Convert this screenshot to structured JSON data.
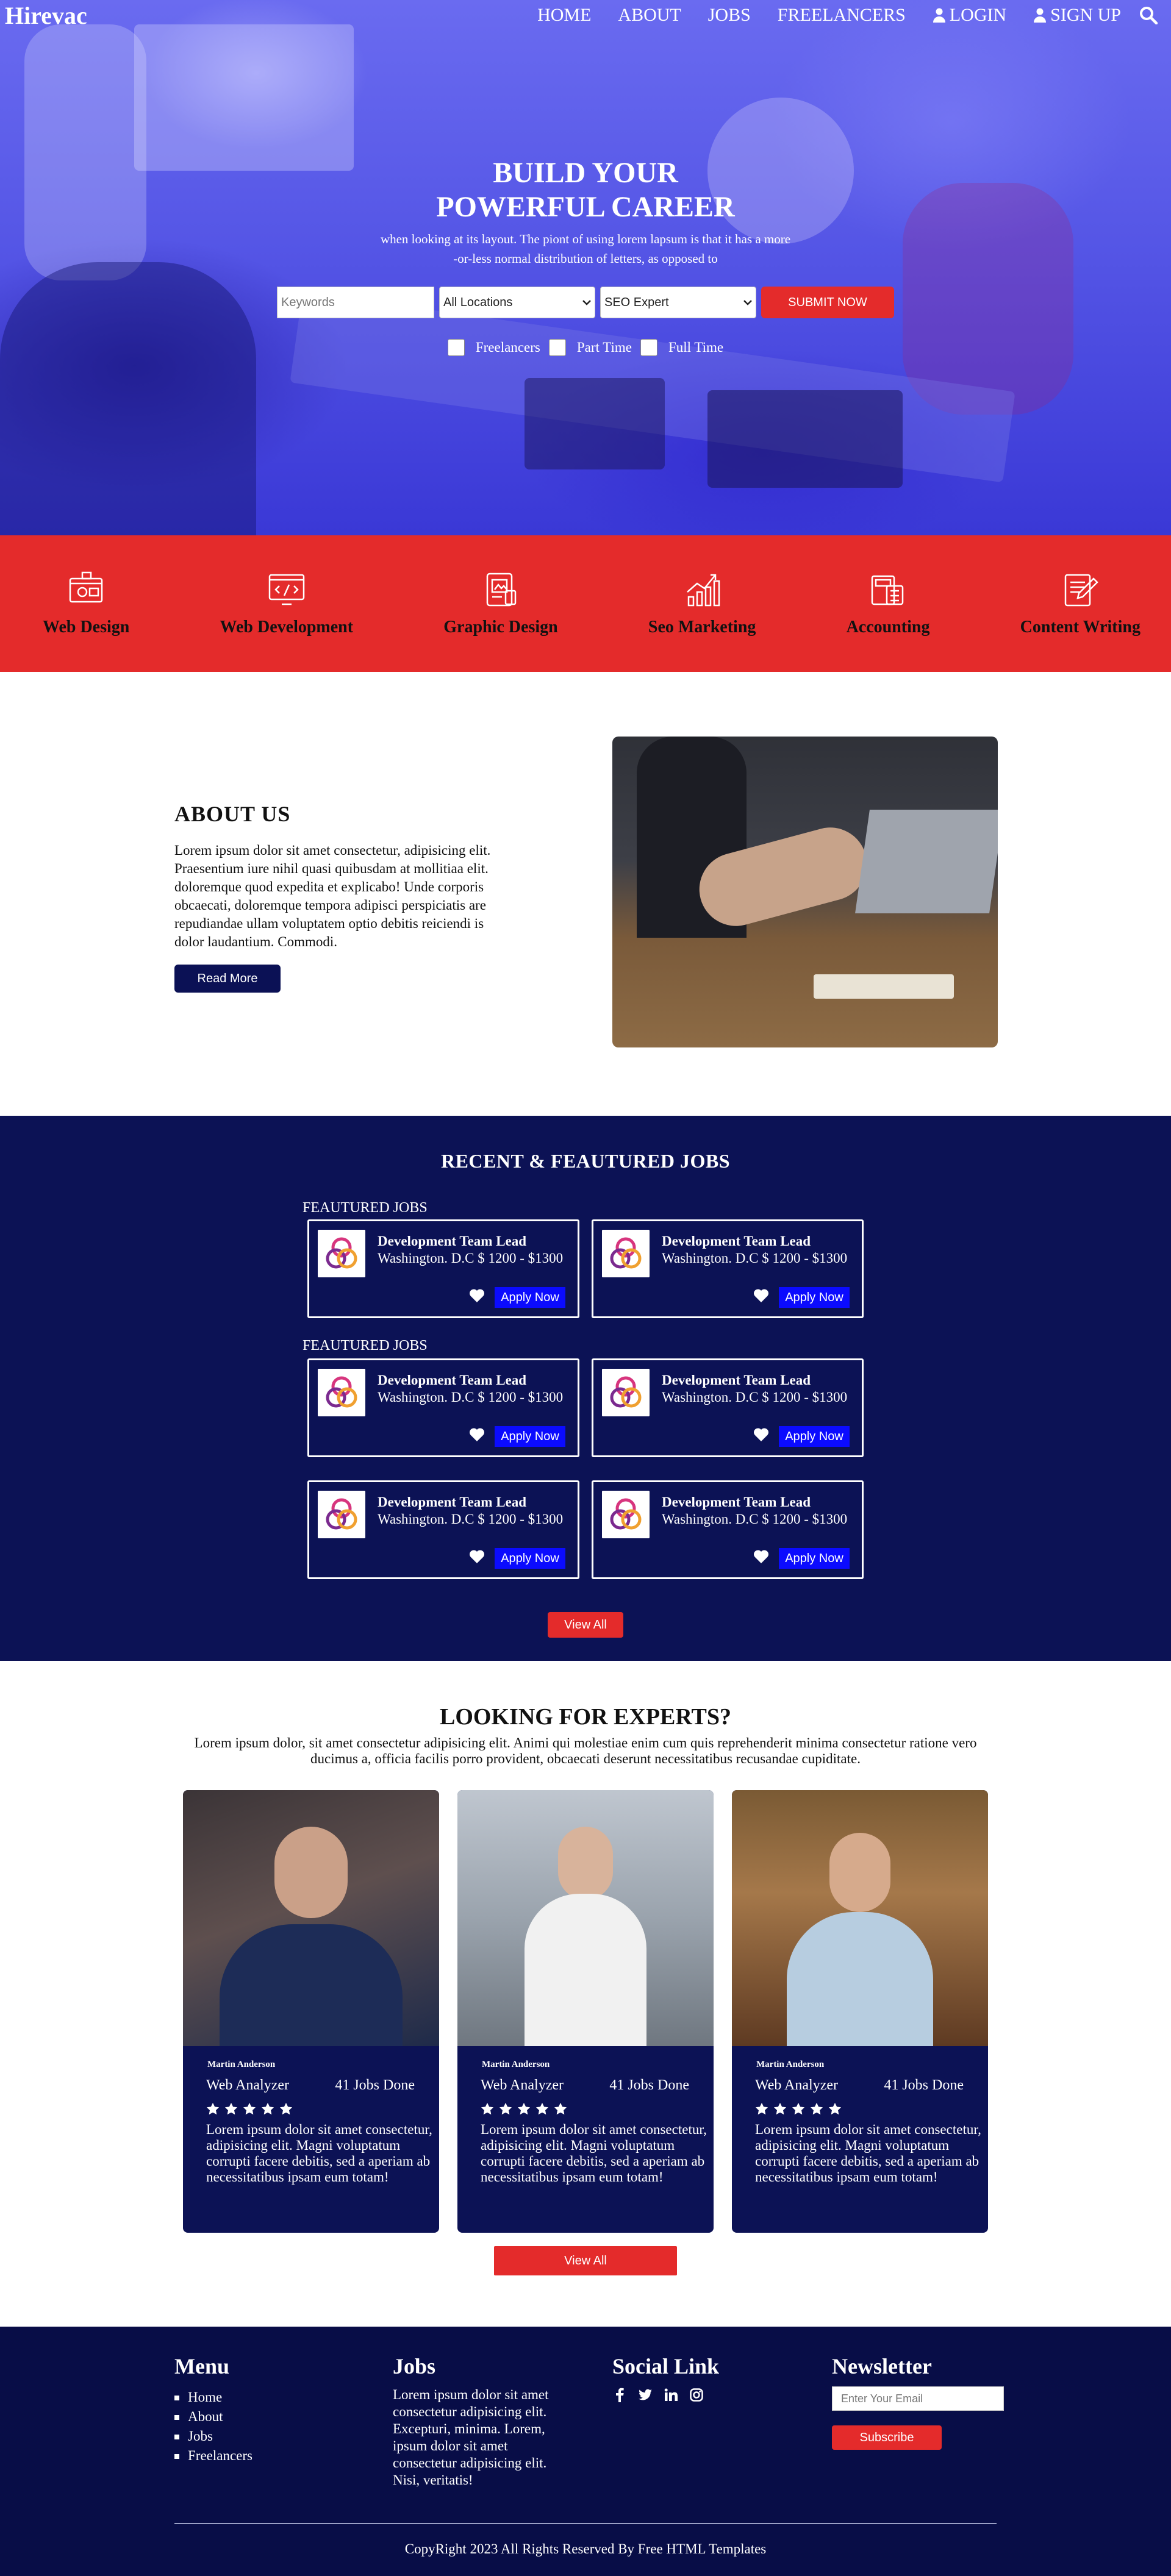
{
  "nav": {
    "brand": "Hirevac",
    "links": [
      "HOME",
      "ABOUT",
      "JOBS",
      "FREELANCERS",
      "LOGIN",
      "SIGN UP"
    ],
    "search_icon": "search-icon",
    "user_icon": "user-icon"
  },
  "hero": {
    "title_line1": "BUILD YOUR",
    "title_line2": "POWERFUL CAREER",
    "subtitle_line1": "when looking at its layout. The piont of using lorem lapsum is that it has a more",
    "subtitle_line2": "-or-less normal distribution of letters, as opposed to",
    "keyword_placeholder": "Keywords",
    "location_value": "All Locations",
    "category_value": "SEO Expert",
    "submit_label": "SUBMIT NOW",
    "filters": [
      "Freelancers",
      "Part Time",
      "Full Time"
    ]
  },
  "categories": [
    {
      "label": "Web Design",
      "icon": "web-design-icon"
    },
    {
      "label": "Web Development",
      "icon": "web-development-icon"
    },
    {
      "label": "Graphic Design",
      "icon": "graphic-design-icon"
    },
    {
      "label": "Seo Marketing",
      "icon": "seo-marketing-icon"
    },
    {
      "label": "Accounting",
      "icon": "accounting-icon"
    },
    {
      "label": "Content Writing",
      "icon": "content-writing-icon"
    }
  ],
  "about": {
    "title": "ABOUT US",
    "body": "Lorem ipsum dolor sit amet consectetur, adipisicing elit. Praesentium iure nihil quasi quibusdam at mollitiaa elit. doloremque quod expedita et explicabo! Unde corporis obcaecati, doloremque tempora adipisci perspiciatis are repudiandae ullam voluptatem optio debitis reiciendi is dolor laudantium. Commodi.",
    "button": "Read More"
  },
  "jobs": {
    "title": "RECENT & FEAUTURED JOBS",
    "group_title": "FEAUTURED JOBS",
    "card_title": "Development Team Lead",
    "card_meta": "Washington. D.C $ 1200 - $1300",
    "apply_label": "Apply Now",
    "view_all": "View All"
  },
  "experts": {
    "title": "LOOKING FOR EXPERTS?",
    "subtitle": "Lorem ipsum dolor, sit amet consectetur adipisicing elit. Animi qui molestiae enim cum quis reprehenderit minima consectetur ratione vero ducimus a, officia facilis porro provident, obcaecati deserunt necessitatibus recusandae cupiditate.",
    "cards": [
      {
        "name": "Martin Anderson",
        "role": "Web Analyzer",
        "jobs": "41 Jobs Done",
        "bio": "Lorem ipsum dolor sit amet consectetur, adipisicing elit. Magni voluptatum corrupti facere debitis, sed a aperiam ab necessitatibus ipsam eum totam!"
      },
      {
        "name": "Martin Anderson",
        "role": "Web Analyzer",
        "jobs": "41 Jobs Done",
        "bio": "Lorem ipsum dolor sit amet consectetur, adipisicing elit. Magni voluptatum corrupti facere debitis, sed a aperiam ab necessitatibus ipsam eum totam!"
      },
      {
        "name": "Martin Anderson",
        "role": "Web Analyzer",
        "jobs": "41 Jobs Done",
        "bio": "Lorem ipsum dolor sit amet consectetur, adipisicing elit. Magni voluptatum corrupti facere debitis, sed a aperiam ab necessitatibus ipsam eum totam!"
      }
    ],
    "rating": 5,
    "view_all": "View All"
  },
  "footer": {
    "menu_title": "Menu",
    "menu_items": [
      "Home",
      "About",
      "Jobs",
      "Freelancers"
    ],
    "jobs_title": "Jobs",
    "jobs_text": "Lorem ipsum dolor sit amet consectetur adipisicing elit. Excepturi, minima. Lorem, ipsum dolor sit amet consectetur adipisicing elit. Nisi, veritatis!",
    "social_title": "Social Link",
    "social_icons": [
      "facebook-icon",
      "twitter-icon",
      "linkedin-icon",
      "instagram-icon"
    ],
    "newsletter_title": "Newsletter",
    "newsletter_placeholder": "Enter Your Email",
    "subscribe_label": "Subscribe",
    "copyright": "CopyRight 2023 All Rights Reserved By Free HTML Templates"
  },
  "colors": {
    "brand_red": "#e42b2b",
    "navy": "#0c1255",
    "footer_navy": "#080d47",
    "apply_blue": "#0b0bff",
    "hero_blue": "#5556e6"
  }
}
